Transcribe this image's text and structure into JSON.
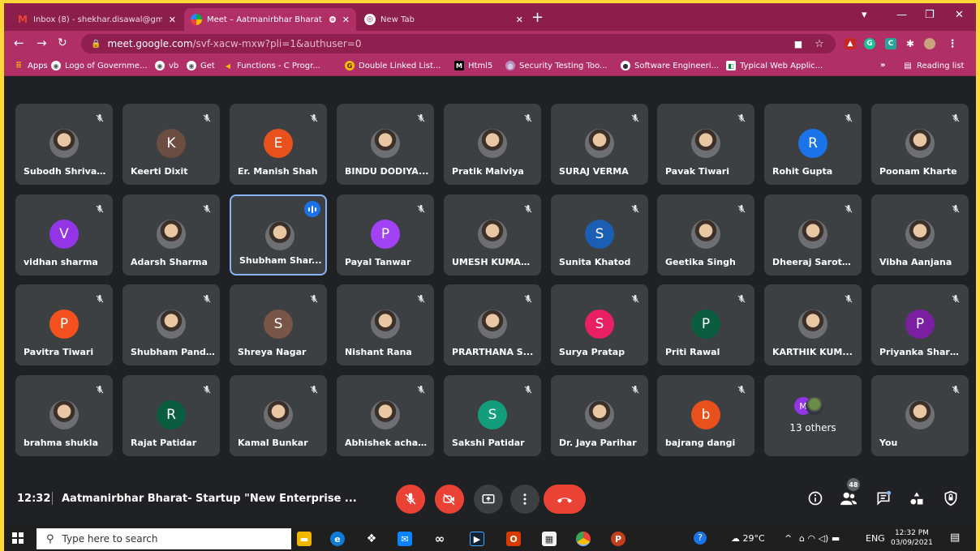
{
  "browser": {
    "tabs": [
      {
        "title": "Inbox (8) - shekhar.disawal@gma",
        "favicon": "gmail-icon"
      },
      {
        "title": "Meet – Aatmanirbhar Bharat",
        "favicon": "meet-icon",
        "recording": true
      },
      {
        "title": "New Tab",
        "favicon": "chrome-icon"
      }
    ],
    "address": {
      "host": "meet.google.com",
      "path": "/svf-xacw-mxw?pli=1&authuser=0"
    },
    "bookmarks": [
      "Apps",
      "Logo of Governme...",
      "vb",
      "Get",
      "Functions - C Progr...",
      "Double Linked List...",
      "Html5",
      "Security Testing Too...",
      "Software Engineeri...",
      "Typical Web Applic..."
    ],
    "bookmarks_more": "»",
    "reading_list": "Reading list"
  },
  "participants": [
    {
      "name": "Subodh Shrivas...",
      "type": "photo"
    },
    {
      "name": "Keerti Dixit",
      "type": "initial",
      "initial": "K",
      "color": "#6d4c41"
    },
    {
      "name": "Er. Manish Shah",
      "type": "initial",
      "initial": "E",
      "color": "#e8511c"
    },
    {
      "name": "BINDU DODIYA...",
      "type": "photo"
    },
    {
      "name": "Pratik Malviya",
      "type": "photo"
    },
    {
      "name": "SURAJ VERMA",
      "type": "photo"
    },
    {
      "name": "Pavak Tiwari",
      "type": "photo"
    },
    {
      "name": "Rohit Gupta",
      "type": "initial",
      "initial": "R",
      "color": "#1a73e8"
    },
    {
      "name": "Poonam Kharte",
      "type": "photo"
    },
    {
      "name": "vidhan sharma",
      "type": "initial",
      "initial": "V",
      "color": "#9334e6"
    },
    {
      "name": "Adarsh Sharma",
      "type": "photo"
    },
    {
      "name": "Shubham Shar...",
      "type": "photo",
      "speaking": true
    },
    {
      "name": "Payal Tanwar",
      "type": "initial",
      "initial": "P",
      "color": "#a142f4"
    },
    {
      "name": "UMESH KUMAR...",
      "type": "photo"
    },
    {
      "name": "Sunita Khatod",
      "type": "initial",
      "initial": "S",
      "color": "#1a5fb4"
    },
    {
      "name": "Geetika Singh",
      "type": "photo"
    },
    {
      "name": "Dheeraj Sarothi...",
      "type": "photo"
    },
    {
      "name": "Vibha Aanjana",
      "type": "photo"
    },
    {
      "name": "Pavitra Tiwari",
      "type": "initial",
      "initial": "P",
      "color": "#f4511e"
    },
    {
      "name": "Shubham Pand...",
      "type": "photo"
    },
    {
      "name": "Shreya Nagar",
      "type": "initial",
      "initial": "S",
      "color": "#795548"
    },
    {
      "name": "Nishant Rana",
      "type": "photo"
    },
    {
      "name": "PRARTHANA S...",
      "type": "photo"
    },
    {
      "name": "Surya Pratap",
      "type": "initial",
      "initial": "S",
      "color": "#e91e63"
    },
    {
      "name": "Priti Rawal",
      "type": "initial",
      "initial": "P",
      "color": "#0b5d3f"
    },
    {
      "name": "KARTHIK KUM...",
      "type": "photo"
    },
    {
      "name": "Priyanka Sharma",
      "type": "initial",
      "initial": "P",
      "color": "#7b1fa2"
    },
    {
      "name": "brahma shukla",
      "type": "photo"
    },
    {
      "name": "Rajat Patidar",
      "type": "initial",
      "initial": "R",
      "color": "#0b5d3f"
    },
    {
      "name": "Kamal Bunkar",
      "type": "photo"
    },
    {
      "name": "Abhishek achar...",
      "type": "photo"
    },
    {
      "name": "Sakshi Patidar",
      "type": "initial",
      "initial": "S",
      "color": "#129e7a"
    },
    {
      "name": "Dr. Jaya Parihar",
      "type": "photo"
    },
    {
      "name": "bajrang dangi",
      "type": "initial",
      "initial": "b",
      "color": "#e8511c"
    },
    {
      "name": "13 others",
      "type": "others",
      "initial": "M"
    },
    {
      "name": "You",
      "type": "photo"
    }
  ],
  "meeting": {
    "time": "12:32",
    "title": "Aatmanirbhar Bharat- Startup \"New Enterprise ...",
    "participant_count": "48"
  },
  "taskbar": {
    "search_placeholder": "Type here to search",
    "weather": "29°C",
    "language": "ENG",
    "time": "12:32 PM",
    "date": "03/09/2021"
  },
  "colors": {
    "tab_strip": "#8b1e4b",
    "toolbar": "#b12f67",
    "meet_bg": "#202124",
    "tile": "#3c4043",
    "danger": "#ea4335"
  }
}
